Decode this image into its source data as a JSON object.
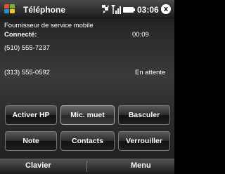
{
  "status": {
    "title": "Téléphone",
    "time": "03:06",
    "close_label": "x"
  },
  "call": {
    "provider": "Fournisseur de service mobile",
    "state_label": "Connecté:",
    "duration": "00:09",
    "number_active": "(510) 555-7237",
    "number_hold": "(313) 555-0592",
    "hold_status": "En attente"
  },
  "buttons": [
    {
      "label": "Activer HP"
    },
    {
      "label": "Mic. muet"
    },
    {
      "label": "Basculer"
    },
    {
      "label": "Note"
    },
    {
      "label": "Contacts"
    },
    {
      "label": "Verrouiller"
    }
  ],
  "softkeys": {
    "left": "Clavier",
    "right": "Menu"
  }
}
